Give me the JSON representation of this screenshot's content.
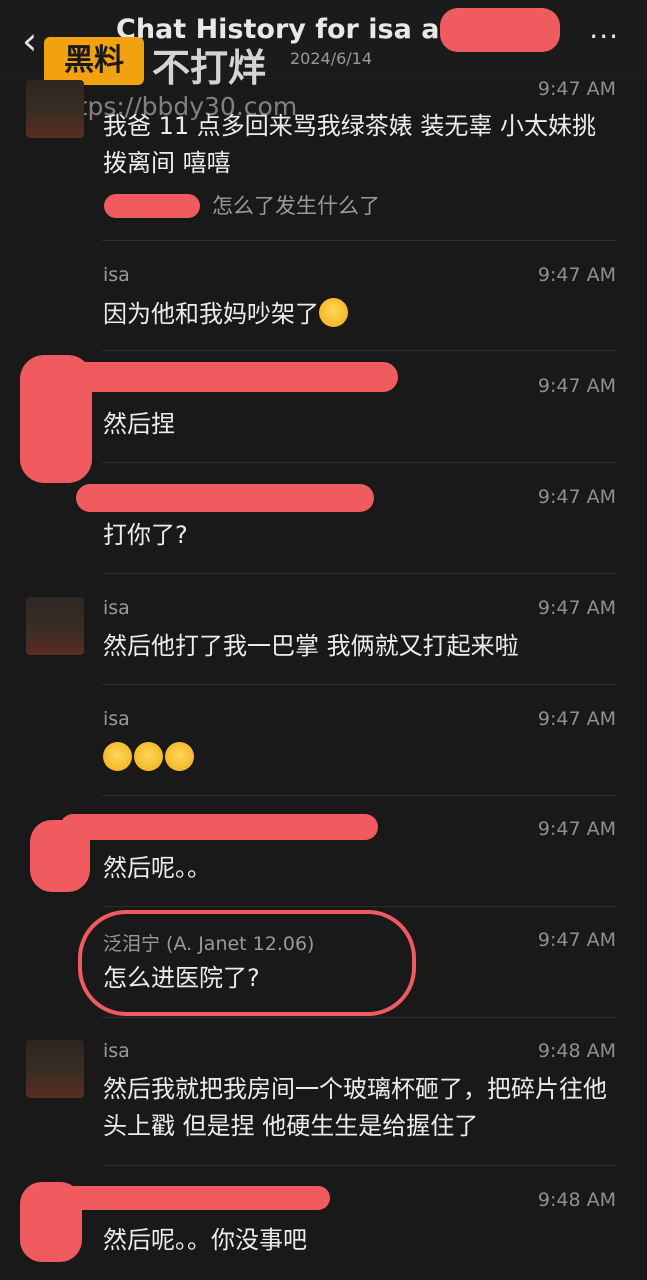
{
  "header": {
    "back_label": "‹",
    "title": "Chat History for isa and",
    "date": "2024/6/14",
    "more_label": "···"
  },
  "watermark": {
    "logo": "黑料",
    "name": "不打烊",
    "url": "https://bbdy30.com"
  },
  "messages": [
    {
      "sender": "isa",
      "time": "9:47 AM",
      "text": "我爸 11 点多回来骂我绿茶婊 装无辜 小太妹挑拨离间 嘻嘻",
      "quote": "怎么了发生什么了"
    },
    {
      "sender": "isa",
      "time": "9:47 AM",
      "text": "因为他和我妈吵架了"
    },
    {
      "sender": "",
      "time": "9:47 AM",
      "text": "然后捏"
    },
    {
      "sender": "",
      "time": "9:47 AM",
      "text": "打你了?"
    },
    {
      "sender": "isa",
      "time": "9:47 AM",
      "text": "然后他打了我一巴掌 我俩就又打起来啦"
    },
    {
      "sender": "isa",
      "time": "9:47 AM",
      "text": ""
    },
    {
      "sender": "",
      "time": "9:47 AM",
      "text": "然后呢。。"
    },
    {
      "sender": "泛泪宁 (A. Janet 12.06)",
      "time": "9:47 AM",
      "text": "怎么进医院了?"
    },
    {
      "sender": "isa",
      "time": "9:48 AM",
      "text": "然后我就把我房间一个玻璃杯砸了，把碎片往他头上戳 但是捏 他硬生生是给握住了"
    },
    {
      "sender": "",
      "time": "9:48 AM",
      "text": "然后呢。。你没事吧"
    }
  ],
  "colors": {
    "background": "#191919",
    "redaction": "#ef5b5f",
    "emoji": "#f5b829"
  }
}
